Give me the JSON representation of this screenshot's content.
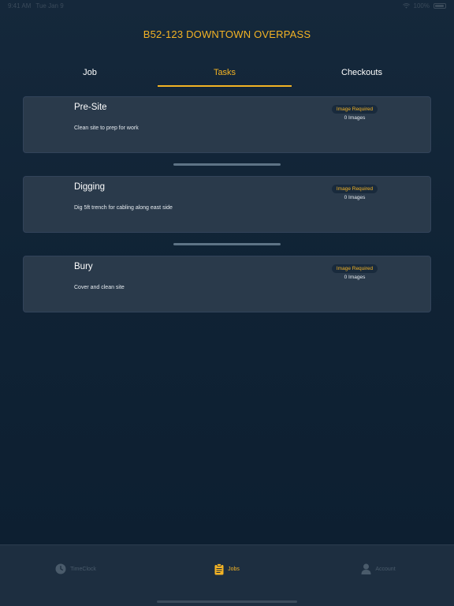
{
  "status_bar": {
    "time": "9:41 AM",
    "date": "Tue Jan 9",
    "battery": "100%"
  },
  "header": {
    "title": "B52-123 DOWNTOWN OVERPASS"
  },
  "tabs": [
    {
      "label": "Job",
      "active": false
    },
    {
      "label": "Tasks",
      "active": true
    },
    {
      "label": "Checkouts",
      "active": false
    }
  ],
  "tasks": [
    {
      "name": "Pre-Site",
      "description": "Clean site to prep for work",
      "badge": "Image Required",
      "image_count": "0 Images"
    },
    {
      "name": "Digging",
      "description": "Dig 5ft trench for cabling along east side",
      "badge": "Image Required",
      "image_count": "0 Images"
    },
    {
      "name": "Bury",
      "description": "Cover and clean site",
      "badge": "Image Required",
      "image_count": "0 Images"
    }
  ],
  "bottom_nav": [
    {
      "label": "TimeClock",
      "icon": "clock-icon",
      "active": false
    },
    {
      "label": "Jobs",
      "icon": "clipboard-icon",
      "active": true
    },
    {
      "label": "Account",
      "icon": "person-icon",
      "active": false
    }
  ],
  "colors": {
    "accent": "#f3b324",
    "background": "#0f2336",
    "card": "#2a3a4b"
  }
}
